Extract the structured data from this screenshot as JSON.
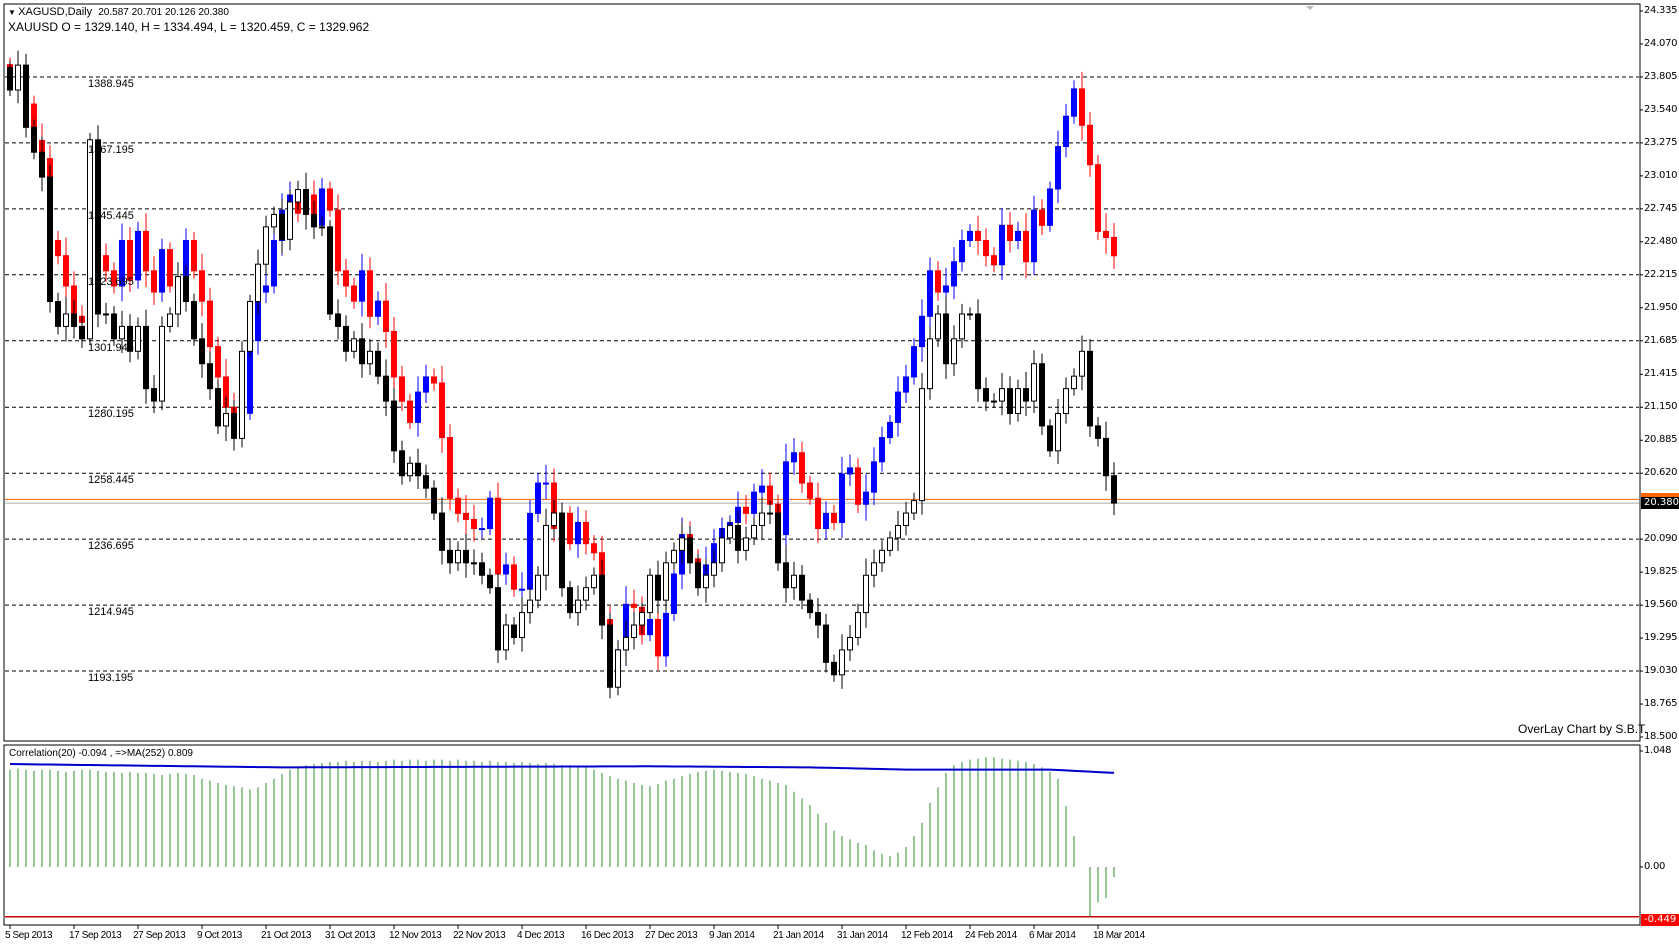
{
  "header": {
    "symbol_line": "XAGUSD,Daily",
    "ohlc_line": "20.587 20.701 20.126 20.380",
    "overlay_line": "XAUUSD O = 1329.140, H = 1334.494, L = 1320.459, C = 1329.962"
  },
  "credit": "OverLay Chart by S.B.T.",
  "indicator_label": "Correlation(20) -0.094 , =>MA(252) 0.809",
  "colors": {
    "bull_overlay": "#0000ff",
    "bear_overlay": "#ff0000",
    "bull_main": "#ffffff",
    "bear_main": "#000000",
    "histogram": "#2e8b2e",
    "ma": "#0000cc",
    "price_line": "#ff6600",
    "level_line": "#cc0000"
  },
  "price_tag": "20.380",
  "level_tag": "-0.449",
  "chart_data": [
    {
      "type": "candlestick",
      "title": "XAGUSD,Daily with XAUUSD overlay",
      "right_axis_ticks": [
        "24.335",
        "24.070",
        "23.805",
        "23.540",
        "23.275",
        "23.010",
        "22.745",
        "22.480",
        "22.215",
        "21.950",
        "21.685",
        "21.415",
        "21.150",
        "20.885",
        "20.620",
        "20.090",
        "19.825",
        "19.560",
        "19.295",
        "19.030",
        "18.765",
        "18.500"
      ],
      "right_axis_values": [
        24.335,
        24.07,
        23.805,
        23.54,
        23.275,
        23.01,
        22.745,
        22.48,
        22.215,
        21.95,
        21.685,
        21.415,
        21.15,
        20.885,
        20.62,
        20.09,
        19.825,
        19.56,
        19.295,
        19.03,
        18.765,
        18.5
      ],
      "ylim": [
        18.5,
        24.335
      ],
      "grid_levels": [
        23.805,
        23.275,
        22.745,
        22.215,
        21.685,
        21.15,
        20.62,
        20.09,
        19.56,
        19.03
      ],
      "overlay_grid_labels": [
        "1388.945",
        "1367.195",
        "1345.445",
        "1323.695",
        "1301.945",
        "1280.195",
        "1258.445",
        "1236.695",
        "1214.945",
        "1193.195"
      ],
      "overlay_scale": {
        "ref_main": 23.805,
        "ref_overlay": 1388.945,
        "main_per_overlay": 0.024368
      },
      "x_labels": [
        "5 Sep 2013",
        "17 Sep 2013",
        "27 Sep 2013",
        "9 Oct 2013",
        "21 Oct 2013",
        "31 Oct 2013",
        "12 Nov 2013",
        "22 Nov 2013",
        "4 Dec 2013",
        "16 Dec 2013",
        "27 Dec 2013",
        "9 Jan 2014",
        "21 Jan 2014",
        "31 Jan 2014",
        "12 Feb 2014",
        "24 Feb 2014",
        "6 Mar 2014",
        "18 Mar 2014"
      ],
      "x_label_every": 8,
      "current_price": 20.38,
      "orange_line": 20.41,
      "main_series_name": "XAGUSD",
      "main_close": [
        23.7,
        23.9,
        23.4,
        23.2,
        23.0,
        22.0,
        21.8,
        21.9,
        21.8,
        21.7,
        23.3,
        21.9,
        21.9,
        21.7,
        21.8,
        21.6,
        21.8,
        21.3,
        21.2,
        21.8,
        21.9,
        22.2,
        22.0,
        21.7,
        21.5,
        21.3,
        21.0,
        21.1,
        20.9,
        21.6,
        22.0,
        22.3,
        22.6,
        22.7,
        22.5,
        22.8,
        22.9,
        22.7,
        22.6,
        22.6,
        21.9,
        21.8,
        21.6,
        21.7,
        21.5,
        21.6,
        21.4,
        21.2,
        20.8,
        20.6,
        20.7,
        20.6,
        20.5,
        20.3,
        20.0,
        19.9,
        20.0,
        19.9,
        19.9,
        19.8,
        19.7,
        19.2,
        19.4,
        19.3,
        19.5,
        19.6,
        19.8,
        20.2,
        20.3,
        19.7,
        19.5,
        19.6,
        19.7,
        19.8,
        19.4,
        18.9,
        19.2,
        19.3,
        19.4,
        19.5,
        19.8,
        19.6,
        19.9,
        20.0,
        20.1,
        19.9,
        19.7,
        19.8,
        19.9,
        20.1,
        20.2,
        20.0,
        20.1,
        20.2,
        20.3,
        20.3,
        19.9,
        19.7,
        19.8,
        19.6,
        19.5,
        19.4,
        19.1,
        19.0,
        19.2,
        19.3,
        19.5,
        19.8,
        19.9,
        20.0,
        20.1,
        20.2,
        20.3,
        20.4,
        21.3,
        21.7,
        21.9,
        21.5,
        21.7,
        21.9,
        21.9,
        21.3,
        21.2,
        21.2,
        21.3,
        21.1,
        21.3,
        21.2,
        21.5,
        21.0,
        20.8,
        21.1,
        21.3,
        21.4,
        21.6,
        21.0,
        20.9,
        20.6,
        20.38
      ],
      "overlay_series_name": "XAUUSD",
      "overlay_close": [
        1385,
        1392,
        1380,
        1368,
        1362,
        1335,
        1330,
        1320,
        1310,
        1308,
        1366,
        1330,
        1325,
        1320,
        1335,
        1322,
        1338,
        1325,
        1318,
        1332,
        1320,
        1322,
        1335,
        1325,
        1315,
        1300,
        1290,
        1280,
        1270,
        1278,
        1302,
        1318,
        1320,
        1335,
        1345,
        1350,
        1344,
        1350,
        1340,
        1352,
        1345,
        1325,
        1320,
        1315,
        1325,
        1310,
        1315,
        1305,
        1290,
        1282,
        1275,
        1285,
        1290,
        1288,
        1270,
        1250,
        1245,
        1243,
        1240,
        1240,
        1250,
        1225,
        1228,
        1220,
        1220,
        1245,
        1255,
        1255,
        1240,
        1245,
        1235,
        1242,
        1235,
        1232,
        1210,
        1195,
        1200,
        1215,
        1214,
        1205,
        1210,
        1198,
        1212,
        1225,
        1238,
        1230,
        1222,
        1228,
        1235,
        1240,
        1242,
        1247,
        1245,
        1252,
        1254,
        1248,
        1238,
        1262,
        1265,
        1255,
        1250,
        1240,
        1245,
        1242,
        1258,
        1260,
        1248,
        1252,
        1262,
        1270,
        1275,
        1285,
        1290,
        1300,
        1310,
        1325,
        1318,
        1320,
        1328,
        1335,
        1338,
        1335,
        1330,
        1327,
        1340,
        1335,
        1338,
        1328,
        1345,
        1340,
        1352,
        1366,
        1376,
        1385,
        1373,
        1360,
        1338,
        1336,
        1329.962
      ]
    },
    {
      "type": "bar",
      "title": "Correlation(20) with MA(252)",
      "ylim": [
        -0.449,
        1.048
      ],
      "axis_ticks": [
        "1.048",
        "0.00"
      ],
      "axis_values": [
        1.048,
        0.0
      ],
      "level": -0.449,
      "values": [
        0.88,
        0.89,
        0.88,
        0.87,
        0.88,
        0.88,
        0.87,
        0.86,
        0.87,
        0.88,
        0.88,
        0.87,
        0.86,
        0.86,
        0.85,
        0.86,
        0.85,
        0.85,
        0.84,
        0.83,
        0.84,
        0.85,
        0.84,
        0.83,
        0.8,
        0.78,
        0.76,
        0.74,
        0.73,
        0.72,
        0.7,
        0.72,
        0.76,
        0.8,
        0.84,
        0.88,
        0.9,
        0.92,
        0.93,
        0.94,
        0.95,
        0.95,
        0.96,
        0.95,
        0.96,
        0.96,
        0.95,
        0.96,
        0.97,
        0.96,
        0.97,
        0.97,
        0.96,
        0.97,
        0.97,
        0.96,
        0.97,
        0.96,
        0.96,
        0.95,
        0.96,
        0.95,
        0.95,
        0.94,
        0.95,
        0.94,
        0.93,
        0.94,
        0.93,
        0.92,
        0.92,
        0.91,
        0.9,
        0.88,
        0.85,
        0.82,
        0.8,
        0.78,
        0.76,
        0.74,
        0.73,
        0.75,
        0.78,
        0.8,
        0.82,
        0.84,
        0.86,
        0.87,
        0.88,
        0.87,
        0.86,
        0.85,
        0.84,
        0.82,
        0.8,
        0.78,
        0.76,
        0.74,
        0.68,
        0.62,
        0.56,
        0.48,
        0.4,
        0.33,
        0.28,
        0.25,
        0.22,
        0.2,
        0.15,
        0.12,
        0.1,
        0.13,
        0.18,
        0.28,
        0.4,
        0.58,
        0.72,
        0.85,
        0.92,
        0.95,
        0.97,
        0.98,
        0.99,
        0.99,
        0.98,
        0.97,
        0.96,
        0.95,
        0.93,
        0.9,
        0.86,
        0.8,
        0.55,
        0.28,
        0.0,
        -0.45,
        -0.32,
        -0.28,
        -0.094
      ],
      "ma_anchors": [
        [
          0,
          0.93
        ],
        [
          34,
          0.9
        ],
        [
          80,
          0.91
        ],
        [
          100,
          0.9
        ],
        [
          112,
          0.88
        ],
        [
          130,
          0.88
        ],
        [
          138,
          0.85
        ]
      ]
    }
  ]
}
